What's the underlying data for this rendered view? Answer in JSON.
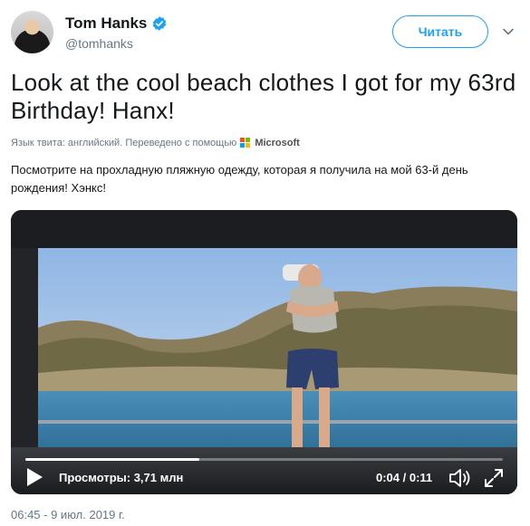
{
  "author": {
    "name": "Tom Hanks",
    "handle": "@tomhanks",
    "verified_icon": "verified-badge-icon"
  },
  "follow_button": {
    "label": "Читать"
  },
  "more_icon": "chevron-down-icon",
  "tweet": {
    "text": "Look at the cool beach clothes I got for my 63rd Birthday!  Hanx!"
  },
  "translation": {
    "note": "Язык твита: английский. Переведено с помощью",
    "provider": "Microsoft",
    "text": "Посмотрите на прохладную пляжную одежду, которая я получила на мой 63-й день рождения!  Хэнкс!"
  },
  "video": {
    "views_label": "Просмотры: 3,71 млн",
    "time": "0:04 / 0:11",
    "progress_fraction": 0.364
  },
  "timestamp": "06:45 - 9 июл. 2019 г.",
  "colors": {
    "accent": "#1da1f2",
    "secondary_text": "#657786"
  }
}
